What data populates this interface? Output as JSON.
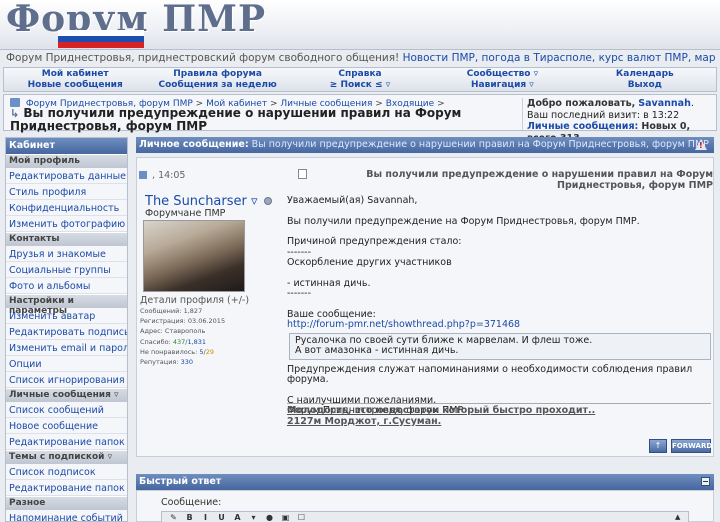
{
  "header": {
    "logo_text": "Форум ПМР",
    "flag_colors": [
      "#ffffff",
      "#1d4fb0",
      "#d62424"
    ],
    "tagline_plain": "Форум Приднестровья, приднестровский форум свободного общения!",
    "tagline_links": "Новости ПМР, погода в Тирасполе, курс валют ПМР, маршруты ПМР"
  },
  "navbar": [
    {
      "line1": "Мой кабинет",
      "line2": "Новые сообщения"
    },
    {
      "line1": "Правила форума",
      "line2": "Сообщения за неделю"
    },
    {
      "line1": "Справка",
      "line2": "≥ Поиск ≤ ▿"
    },
    {
      "line1": "Сообщество ▿",
      "line2": "Навигация ▿"
    },
    {
      "line1": "Календарь",
      "line2": "Выход"
    }
  ],
  "breadcrumb": {
    "items": [
      "Форум Приднестровья, форум ПМР",
      "Мой кабинет",
      "Личные сообщения",
      "Входящие"
    ],
    "separator": ">",
    "page_title": "Вы получили предупреждение о нарушении правил на Форум Приднестровья, форум ПМР",
    "arrow": "↳"
  },
  "welcome": {
    "greeting": "Добро пожаловать,",
    "username": "Savannah",
    "last_visit_label": "Ваш последний визит:",
    "last_visit_value": "в 13:22",
    "pm_label": "Личные сообщения:",
    "pm_value": "Новых 0, всего 313."
  },
  "sidebar": {
    "title": "Кабинет",
    "groups": [
      {
        "section": "Мой профиль",
        "links": [
          "Редактировать данные",
          "Стиль профиля",
          "Конфиденциальность",
          "Изменить фотографию"
        ]
      },
      {
        "section": "Контакты",
        "links": [
          "Друзья и знакомые",
          "Социальные группы",
          "Фото и альбомы"
        ]
      },
      {
        "section": "Настройки и параметры",
        "links": [
          "Изменить аватар",
          "Редактировать подпись",
          "Изменить email и пароль",
          "Опции",
          "Список игнорирования"
        ]
      },
      {
        "section": "Личные сообщения ▿",
        "links": [
          "Список сообщений",
          "Новое сообщение",
          "Редактирование папок"
        ]
      },
      {
        "section": "Темы с подпиской ▿",
        "links": [
          "Список подписок",
          "Редактирование папок"
        ]
      },
      {
        "section": "Разное",
        "links": [
          "Напоминание событий"
        ]
      }
    ]
  },
  "pm_bar": {
    "label": "Личное сообщение:",
    "subject": "Вы получили предупреждение о нарушении правил на Форум Приднестровья, форум ПМР"
  },
  "post": {
    "date": ", 14:05",
    "title": "Вы получили предупреждение о нарушении правил на Форум Приднестровья, форум ПМР",
    "author": {
      "name": "The Suncharser",
      "name_suffix": "▿",
      "group": "Форумчане ПМР",
      "details_label": "Детали профиля (+/-)",
      "messages_label": "Сообщений:",
      "messages_value": "1,827",
      "registered_label": "Регистрация:",
      "registered_value": "03.06.2015",
      "address_label": "Адрес:",
      "address_value": "Ставрополь",
      "thanks_label": "Спасибо:",
      "thanks_given": "437",
      "thanks_received": "1,831",
      "disliked_label": "Не понравилось:",
      "disliked_given": "5",
      "disliked_received": "29",
      "reputation_label": "Репутация:",
      "reputation_value": "330"
    },
    "body": {
      "greeting": "Уважаемый(ая) Savannah,",
      "line1": "Вы получили предупреждение на Форум Приднестровья, форум ПМР.",
      "reason_label": "Причиной предупреждения стало:",
      "dashes1": "-------",
      "reason": "Оскорбление других участников",
      "extra": "- истинная дичь.",
      "dashes2": "-------",
      "your_message_label": "Ваше сообщение:",
      "link": "http://forum-pmr.net/showthread.php?p=371468",
      "quote_line1": "Русалочка по своей сути ближе к марвелам. И флеш тоже.",
      "quote_line2": "А вот амазонка - истинная дичь.",
      "notice": "Предупреждения служат напоминаниями о необходимости соблюдения правил форума.",
      "regards": "С наилучшими пожеланиями,",
      "sign": "Форум Приднестровья, форум ПМР"
    },
    "signature_line1": "Молодость, это недостаток который быстро проходит..",
    "signature_line2": "2127м Морджот, г.Сусуман.",
    "up_button": "↑",
    "forward_button": "FORWARD"
  },
  "quick_reply": {
    "title": "Быстрый ответ",
    "message_label": "Сообщение:",
    "toolbar": [
      "✎",
      "B",
      "I",
      "U",
      "A",
      "▾",
      "●",
      "▣",
      "☐"
    ],
    "scroll_up": "▲"
  }
}
